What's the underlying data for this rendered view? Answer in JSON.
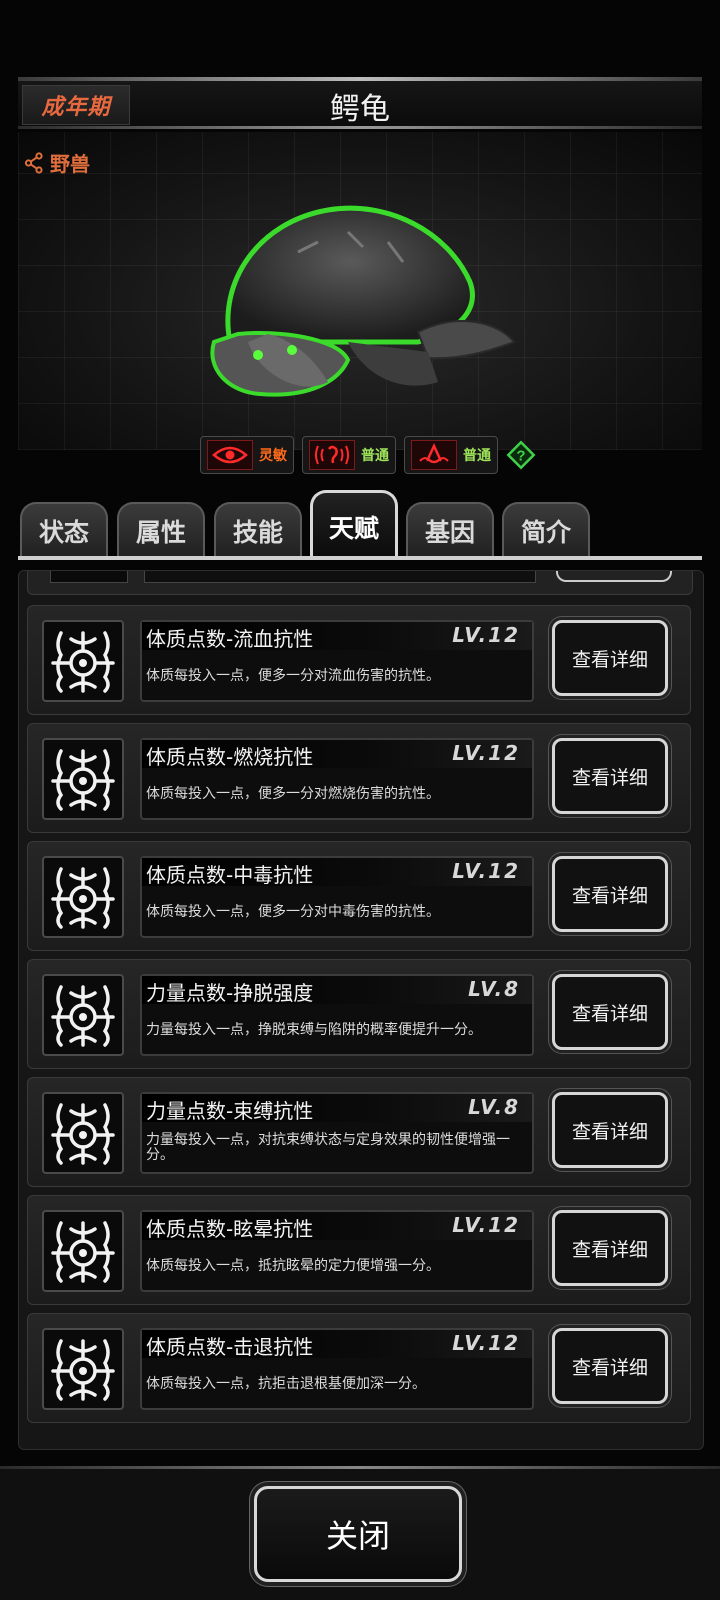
{
  "header": {
    "stage": "成年期",
    "creature_name": "鳄龟"
  },
  "category": {
    "label": "野兽",
    "icon": "share-icon"
  },
  "senses": [
    {
      "icon": "eye-icon",
      "label": "灵敏",
      "color": "#ff6a1a"
    },
    {
      "icon": "ear-icon",
      "label": "普通",
      "color": "#9ee35a"
    },
    {
      "icon": "nose-icon",
      "label": "普通",
      "color": "#9ee35a"
    }
  ],
  "help": {
    "icon": "question-icon",
    "color": "#3fd14a"
  },
  "tabs": [
    {
      "label": "状态",
      "active": false
    },
    {
      "label": "属性",
      "active": false
    },
    {
      "label": "技能",
      "active": false
    },
    {
      "label": "天赋",
      "active": true
    },
    {
      "label": "基因",
      "active": false
    },
    {
      "label": "简介",
      "active": false
    }
  ],
  "talents": [
    {
      "name": "体质点数-流血抗性",
      "level": "LV.12",
      "desc": "体质每投入一点，便多一分对流血伤害的抗性。",
      "button": "查看详细"
    },
    {
      "name": "体质点数-燃烧抗性",
      "level": "LV.12",
      "desc": "体质每投入一点，便多一分对燃烧伤害的抗性。",
      "button": "查看详细"
    },
    {
      "name": "体质点数-中毒抗性",
      "level": "LV.12",
      "desc": "体质每投入一点，便多一分对中毒伤害的抗性。",
      "button": "查看详细"
    },
    {
      "name": "力量点数-挣脱强度",
      "level": "LV.8",
      "desc": "力量每投入一点，挣脱束缚与陷阱的概率便提升一分。",
      "button": "查看详细"
    },
    {
      "name": "力量点数-束缚抗性",
      "level": "LV.8",
      "desc": "力量每投入一点，对抗束缚状态与定身效果的韧性便增强一分。",
      "button": "查看详细"
    },
    {
      "name": "体质点数-眩晕抗性",
      "level": "LV.12",
      "desc": "体质每投入一点，抵抗眩晕的定力便增强一分。",
      "button": "查看详细"
    },
    {
      "name": "体质点数-击退抗性",
      "level": "LV.12",
      "desc": "体质每投入一点，抗拒击退根基便加深一分。",
      "button": "查看详细"
    }
  ],
  "footer": {
    "close_label": "关闭"
  }
}
